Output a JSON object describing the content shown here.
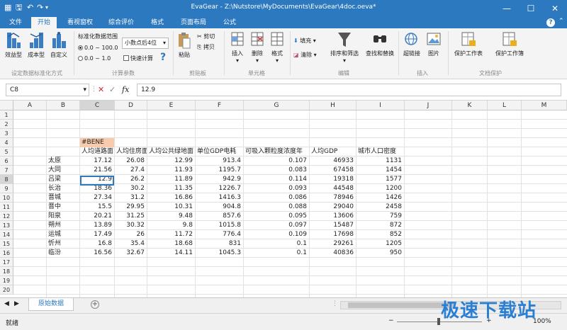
{
  "titlebar": {
    "app_name": "EvaGear",
    "separator": "-",
    "file_path": "Z:\\Nutstore\\MyDocuments\\EvaGear\\4doc.oeva*"
  },
  "menu": {
    "tabs": [
      "文件",
      "开始",
      "看视窗权",
      "综合评价",
      "格式",
      "页面布局",
      "公式"
    ],
    "active_index": 1,
    "help": "?"
  },
  "ribbon": {
    "std_buttons": [
      "效益型",
      "成本型",
      "自定义"
    ],
    "std_range_label": "标准化数据范围",
    "radio_1": "0.0 ~ 100.0",
    "radio_2": "0.0 ~ 1.0",
    "decimal_select": "小数点后4位",
    "quick_calc": "快速计算",
    "paste": "粘贴",
    "cut": "剪切",
    "copy": "拷贝",
    "insert": "插入",
    "delete": "删除",
    "format": "格式",
    "fill": "填充",
    "clear": "清除",
    "sort_filter": "排序和筛选",
    "find_replace": "查找和替换",
    "hyperlink": "超链接",
    "image": "图片",
    "protect_sheet": "保护工作表",
    "protect_book": "保护工作簿",
    "groups": [
      "设定数据标准化方式",
      "计算参数",
      "剪贴板",
      "单元格",
      "编辑",
      "插入",
      "文档保护"
    ]
  },
  "formula_bar": {
    "name_box": "C8",
    "cancel": "✕",
    "confirm": "✓",
    "fx": "fx",
    "value": "12.9"
  },
  "sheet": {
    "columns": [
      "A",
      "B",
      "C",
      "D",
      "E",
      "F",
      "G",
      "H",
      "I",
      "J",
      "K",
      "L",
      "M"
    ],
    "selected_column": "C",
    "rows": [
      "1",
      "2",
      "3",
      "4",
      "5",
      "6",
      "7",
      "8",
      "9",
      "10",
      "11",
      "12",
      "13",
      "14",
      "15",
      "16",
      "17",
      "18",
      "19",
      "20"
    ],
    "selected_row": "8",
    "tag_cell": "#BENE",
    "headers": [
      "人均道路面",
      "人均住房面",
      "人均公共绿地面",
      "单位GDP电耗",
      "可吸入颗粒度浓度年",
      "人均GDP",
      "城市人口密度"
    ],
    "data": [
      {
        "city": "太原",
        "vals": [
          "17.12",
          "26.08",
          "12.99",
          "913.4",
          "0.107",
          "46933",
          "1131"
        ]
      },
      {
        "city": "大同",
        "vals": [
          "21.56",
          "27.4",
          "11.93",
          "1195.7",
          "0.083",
          "67458",
          "1454"
        ]
      },
      {
        "city": "吕梁",
        "vals": [
          "12.9",
          "26.2",
          "11.89",
          "942.9",
          "0.114",
          "19318",
          "1577"
        ]
      },
      {
        "city": "长治",
        "vals": [
          "18.36",
          "30.2",
          "11.35",
          "1226.7",
          "0.093",
          "44548",
          "1200"
        ]
      },
      {
        "city": "晋城",
        "vals": [
          "27.34",
          "31.2",
          "16.86",
          "1416.3",
          "0.086",
          "78946",
          "1426"
        ]
      },
      {
        "city": "晋中",
        "vals": [
          "15.5",
          "29.95",
          "10.31",
          "904.8",
          "0.088",
          "29040",
          "2458"
        ]
      },
      {
        "city": "阳泉",
        "vals": [
          "20.21",
          "31.25",
          "9.48",
          "857.6",
          "0.095",
          "13606",
          "759"
        ]
      },
      {
        "city": "朔州",
        "vals": [
          "13.89",
          "30.32",
          "9.8",
          "1015.8",
          "0.097",
          "15487",
          "872"
        ]
      },
      {
        "city": "运城",
        "vals": [
          "17.49",
          "26",
          "11.72",
          "776.4",
          "0.109",
          "17698",
          "852"
        ]
      },
      {
        "city": "忻州",
        "vals": [
          "16.8",
          "35.4",
          "18.68",
          "831",
          "0.1",
          "29261",
          "1205"
        ]
      },
      {
        "city": "临汾",
        "vals": [
          "16.56",
          "32.67",
          "14.11",
          "1045.3",
          "0.1",
          "40836",
          "950"
        ]
      }
    ]
  },
  "tabs": {
    "sheet_name": "原始数据",
    "add": "+"
  },
  "status": {
    "ready": "就绪",
    "zoom": "100%"
  },
  "watermark": "极速下载站"
}
